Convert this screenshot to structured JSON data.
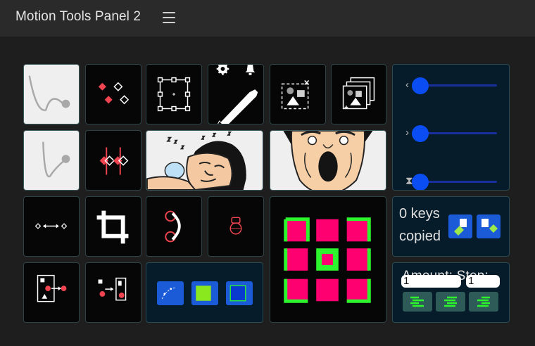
{
  "header": {
    "title": "Motion Tools Panel 2",
    "menu_icon": "hamburger-menu-icon"
  },
  "sliders": [
    {
      "name": "slider-1",
      "icon": "chevron-left-icon",
      "glyph": "‹",
      "level": 0.06
    },
    {
      "name": "slider-2",
      "icon": "chevron-right-icon",
      "glyph": "›",
      "level": 0.06
    },
    {
      "name": "slider-3",
      "icon": "hourglass-icon",
      "glyph": "⧗",
      "level": 0.06
    }
  ],
  "keys": {
    "line1": "0 keys",
    "line2": "copied"
  },
  "amount": {
    "label": "Amount: Step:",
    "amount_value": "1",
    "step_value": "1"
  },
  "colors": {
    "tile_bg": "#060606",
    "tile_border": "#2c4448",
    "accent_blue": "#1b5bd8",
    "grid_pink": "#ff0070",
    "grid_green": "#2df52d",
    "slider_track": "#1a2fa0",
    "slider_knob": "#0a4df2"
  }
}
